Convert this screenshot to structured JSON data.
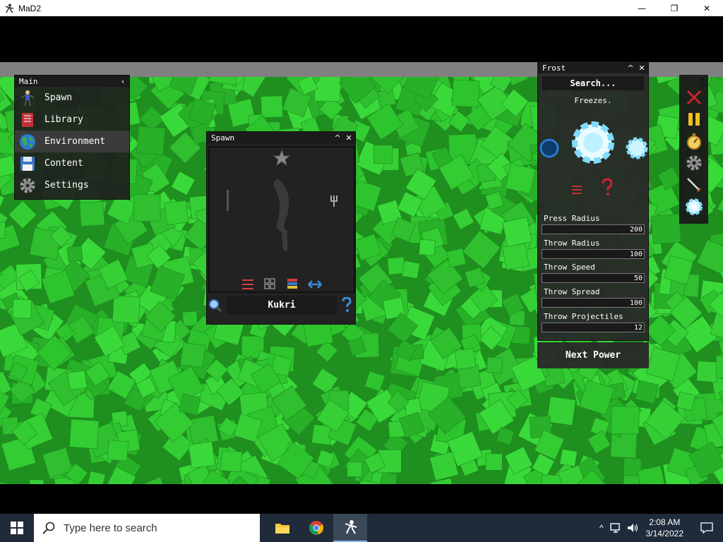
{
  "window": {
    "title": "MaD2",
    "controls": [
      "—",
      "❐",
      "✕"
    ]
  },
  "main_menu": {
    "title": "Main",
    "collapse": "‹",
    "items": [
      {
        "label": "Spawn",
        "icon": "person-icon"
      },
      {
        "label": "Library",
        "icon": "book-icon"
      },
      {
        "label": "Environment",
        "icon": "globe-icon"
      },
      {
        "label": "Content",
        "icon": "floppy-icon"
      },
      {
        "label": "Settings",
        "icon": "gear-icon"
      }
    ]
  },
  "spawn_window": {
    "title": "Spawn",
    "item_name": "Kukri"
  },
  "frost_panel": {
    "title": "Frost",
    "search_placeholder": "Search...",
    "description": "Freezes.",
    "sliders": [
      {
        "label": "Press Radius",
        "value": "200"
      },
      {
        "label": "Throw Radius",
        "value": "100"
      },
      {
        "label": "Throw Speed",
        "value": "50"
      },
      {
        "label": "Throw Spread",
        "value": "100"
      },
      {
        "label": "Throw Projectiles",
        "value": "12"
      }
    ],
    "next_power_label": "Next Power"
  },
  "toolbar": {
    "collapse": "‹",
    "tools": [
      "close-x-icon",
      "pause-icon",
      "stopwatch-icon",
      "gear-icon",
      "sword-icon",
      "frost-icon"
    ]
  },
  "taskbar": {
    "search_placeholder": "Type here to search",
    "time": "2:08 AM",
    "date": "3/14/2022"
  },
  "colors": {
    "grass": "#33cc33",
    "grass_dark": "#22a522",
    "frost": "#7fdcff",
    "panel": "#2b2b2b"
  }
}
